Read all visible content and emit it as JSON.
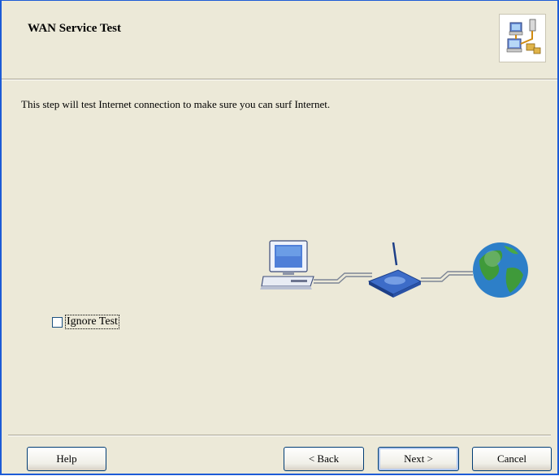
{
  "header": {
    "title": "WAN Service Test",
    "icon": "network-wizard-icon"
  },
  "body": {
    "description": "This step will test Internet connection to make sure you can surf Internet.",
    "illustration": [
      "computer-icon",
      "router-icon",
      "globe-icon"
    ],
    "ignore_test_label": "Ignore Test",
    "ignore_test_checked": false
  },
  "buttons": {
    "help": "Help",
    "back": "< Back",
    "next": "Next >",
    "cancel": "Cancel"
  },
  "colors": {
    "window_border": "#1c5bd6",
    "background": "#ece9d8",
    "button_border": "#003c74"
  }
}
